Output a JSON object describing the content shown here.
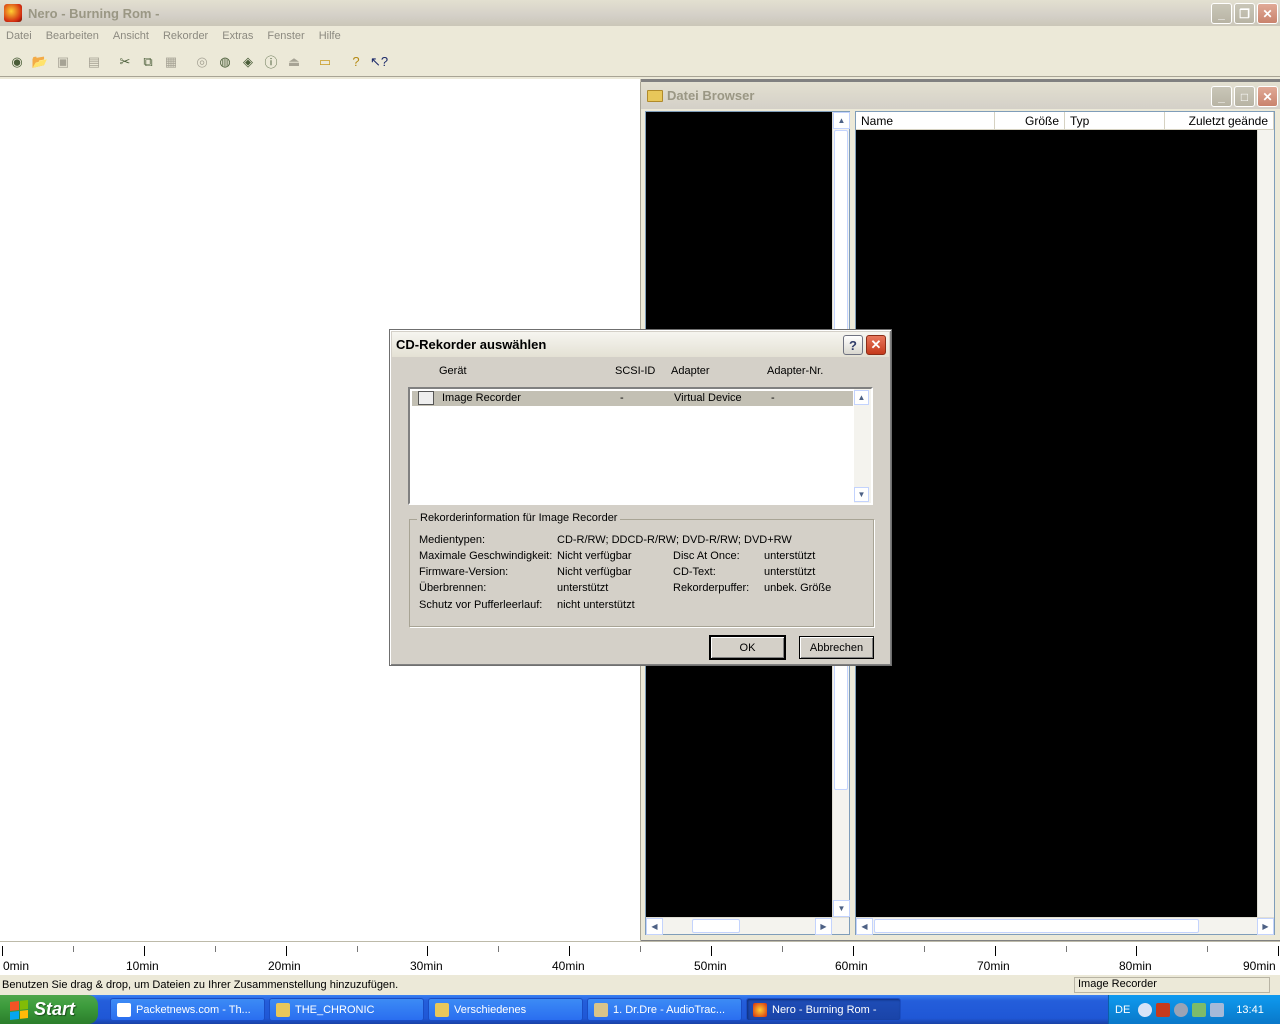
{
  "app": {
    "title": "Nero - Burning Rom -",
    "menu": [
      "Datei",
      "Bearbeiten",
      "Ansicht",
      "Rekorder",
      "Extras",
      "Fenster",
      "Hilfe"
    ]
  },
  "browser": {
    "title": "Datei Browser",
    "columns": [
      "Name",
      "Größe",
      "Typ",
      "Zuletzt geände"
    ]
  },
  "dialog": {
    "title": "CD-Rekorder auswählen",
    "help_label": "?",
    "columns": [
      "Gerät",
      "SCSI-ID",
      "Adapter",
      "Adapter-Nr."
    ],
    "recorders": [
      {
        "device": "Image Recorder",
        "scsi_id": "-",
        "adapter": "Virtual Device",
        "adapter_nr": "-"
      }
    ],
    "group_title": "Rekorderinformation für Image Recorder",
    "info": {
      "media_label": "Medientypen:",
      "media_value": "CD-R/RW; DDCD-R/RW; DVD-R/RW; DVD+RW",
      "maxspeed_label": "Maximale Geschwindigkeit:",
      "maxspeed_value": "Nicht verfügbar",
      "firmware_label": "Firmware-Version:",
      "firmware_value": "Nicht verfügbar",
      "overburn_label": "Überbrennen:",
      "overburn_value": "unterstützt",
      "buffer_label": "Schutz vor Pufferleerlauf:",
      "buffer_value": "nicht unterstützt",
      "dao_label": "Disc At Once:",
      "dao_value": "unterstützt",
      "cdtext_label": "CD-Text:",
      "cdtext_value": "unterstützt",
      "recbuf_label": "Rekorderpuffer:",
      "recbuf_value": "unbek. Größe"
    },
    "ok_label": "OK",
    "cancel_label": "Abbrechen"
  },
  "timeline": {
    "labels": [
      "0min",
      "10min",
      "20min",
      "30min",
      "40min",
      "50min",
      "60min",
      "70min",
      "80min",
      "90min"
    ]
  },
  "status": {
    "hint": "Benutzen Sie drag & drop, um Dateien zu Ihrer Zusammenstellung hinzuzufügen.",
    "recorder": "Image Recorder"
  },
  "taskbar": {
    "start_label": "Start",
    "tasks": [
      "Packetnews.com - Th...",
      "THE_CHRONIC",
      "Verschiedenes",
      "1. Dr.Dre - AudioTrac...",
      "Nero - Burning Rom -"
    ],
    "lang": "DE",
    "clock": "13:41"
  },
  "icons": {
    "toolbar": [
      "new-compilation-icon",
      "open-icon",
      "save-icon",
      "properties-icon",
      "cut-icon",
      "copy-icon",
      "paste-icon",
      "burn-icon",
      "copy-disc-icon",
      "disc-info-icon",
      "recorder-info-icon",
      "eject-icon",
      "file-browser-icon",
      "help-icon",
      "context-help-icon"
    ]
  },
  "colors": {
    "taskbar": "#245edb",
    "start": "#3c9b3c",
    "dialog_close": "#c53a1c"
  }
}
